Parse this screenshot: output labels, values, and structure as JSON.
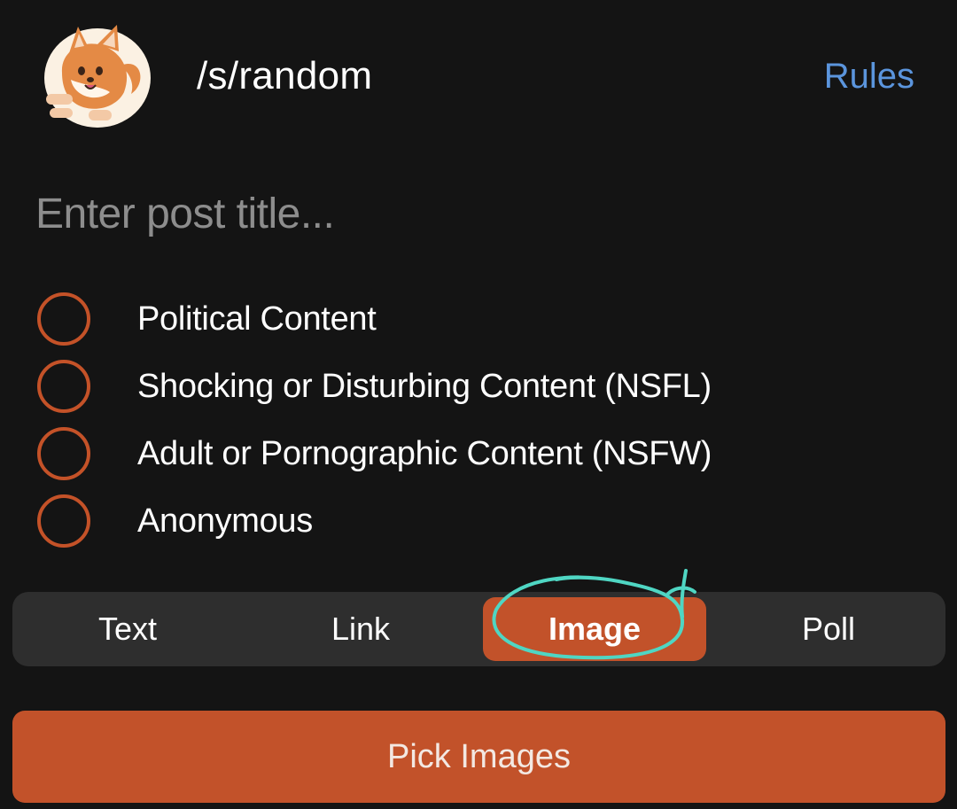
{
  "header": {
    "avatar_icon": "shiba-dog-avatar-icon",
    "community_name": "/s/random",
    "rules_label": "Rules"
  },
  "post": {
    "title_placeholder": "Enter post title...",
    "title_value": ""
  },
  "options": [
    {
      "label": "Political Content",
      "selected": false
    },
    {
      "label": "Shocking or Disturbing Content (NSFL)",
      "selected": false
    },
    {
      "label": "Adult or Pornographic Content (NSFW)",
      "selected": false
    },
    {
      "label": "Anonymous",
      "selected": false
    }
  ],
  "post_types": {
    "tabs": [
      {
        "label": "Text"
      },
      {
        "label": "Link"
      },
      {
        "label": "Image"
      },
      {
        "label": "Poll"
      }
    ],
    "active": "Image"
  },
  "actions": {
    "pick_label": "Pick Images"
  },
  "colors": {
    "background": "#141414",
    "accent": "#c2522a",
    "radio_border": "#c45228",
    "link": "#5b95dd",
    "tab_bar": "#2e2e2e",
    "annotation": "#4fd6c3"
  }
}
